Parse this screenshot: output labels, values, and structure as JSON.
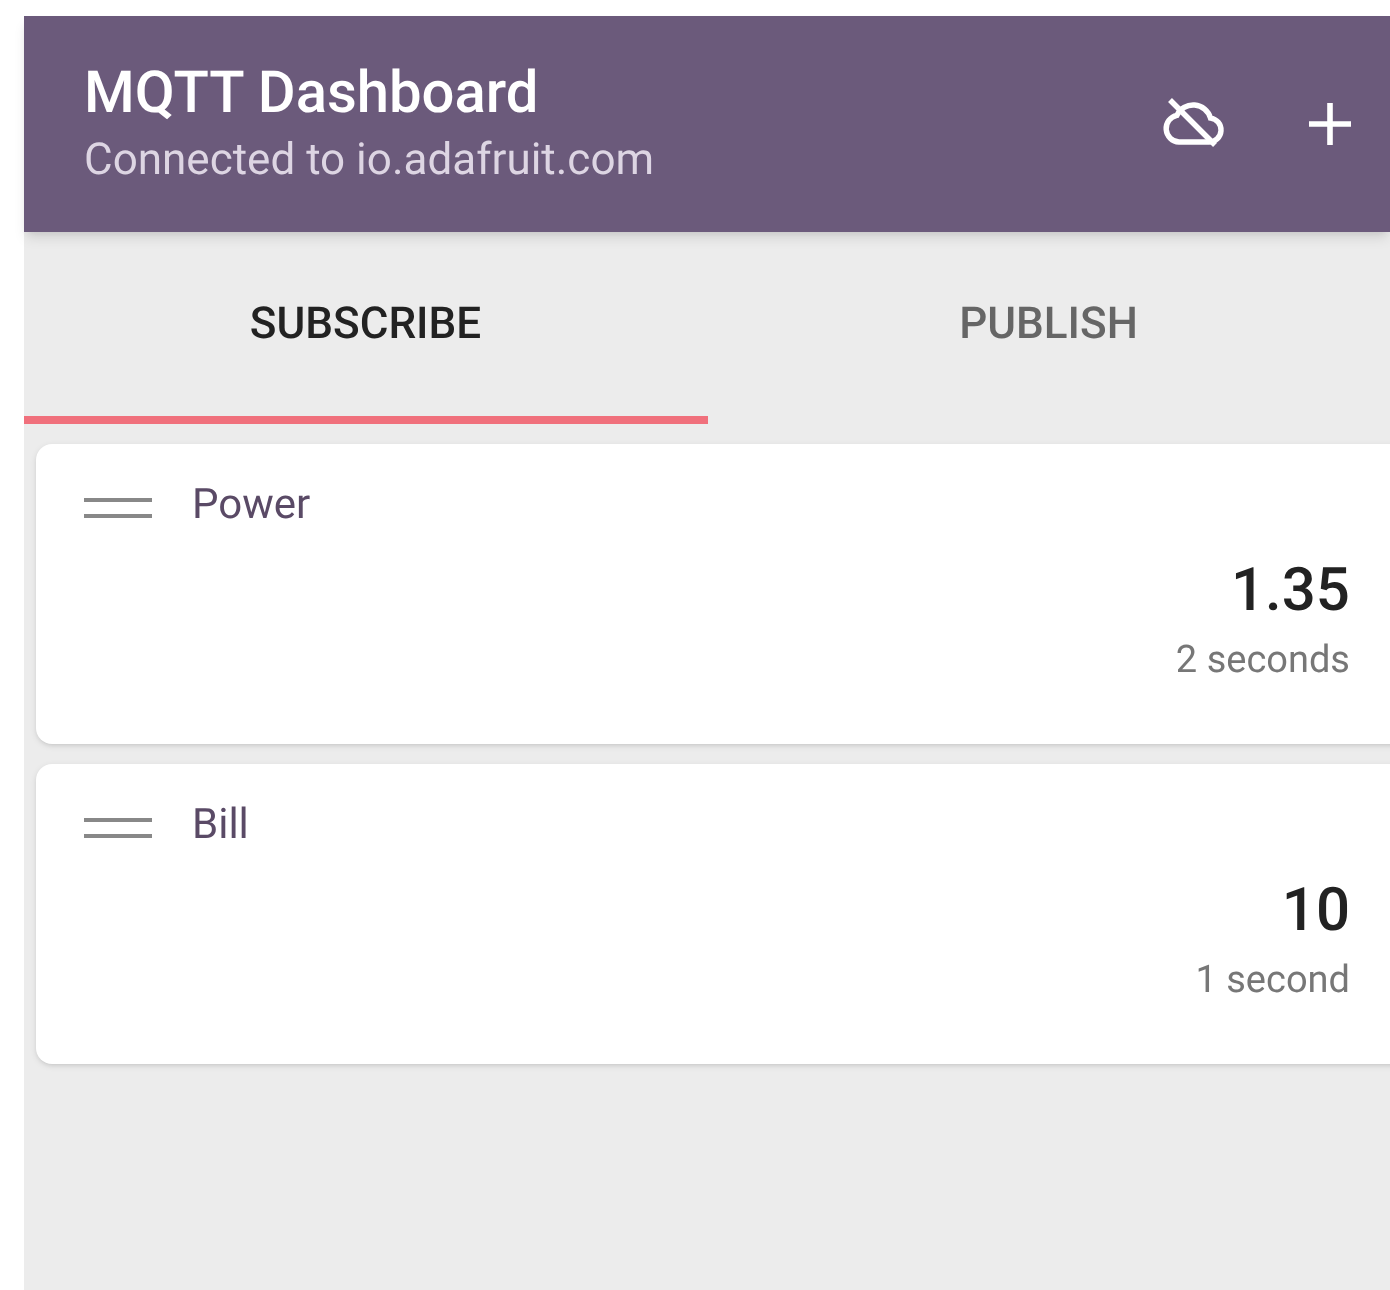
{
  "header": {
    "title": "MQTT Dashboard",
    "subtitle": "Connected to io.adafruit.com"
  },
  "tabs": [
    {
      "label": "SUBSCRIBE",
      "selected": true
    },
    {
      "label": "PUBLISH",
      "selected": false
    }
  ],
  "cards": [
    {
      "name": "Power",
      "value": "1.35",
      "age": "2 seconds"
    },
    {
      "name": "Bill",
      "value": "10",
      "age": "1 second"
    }
  ]
}
